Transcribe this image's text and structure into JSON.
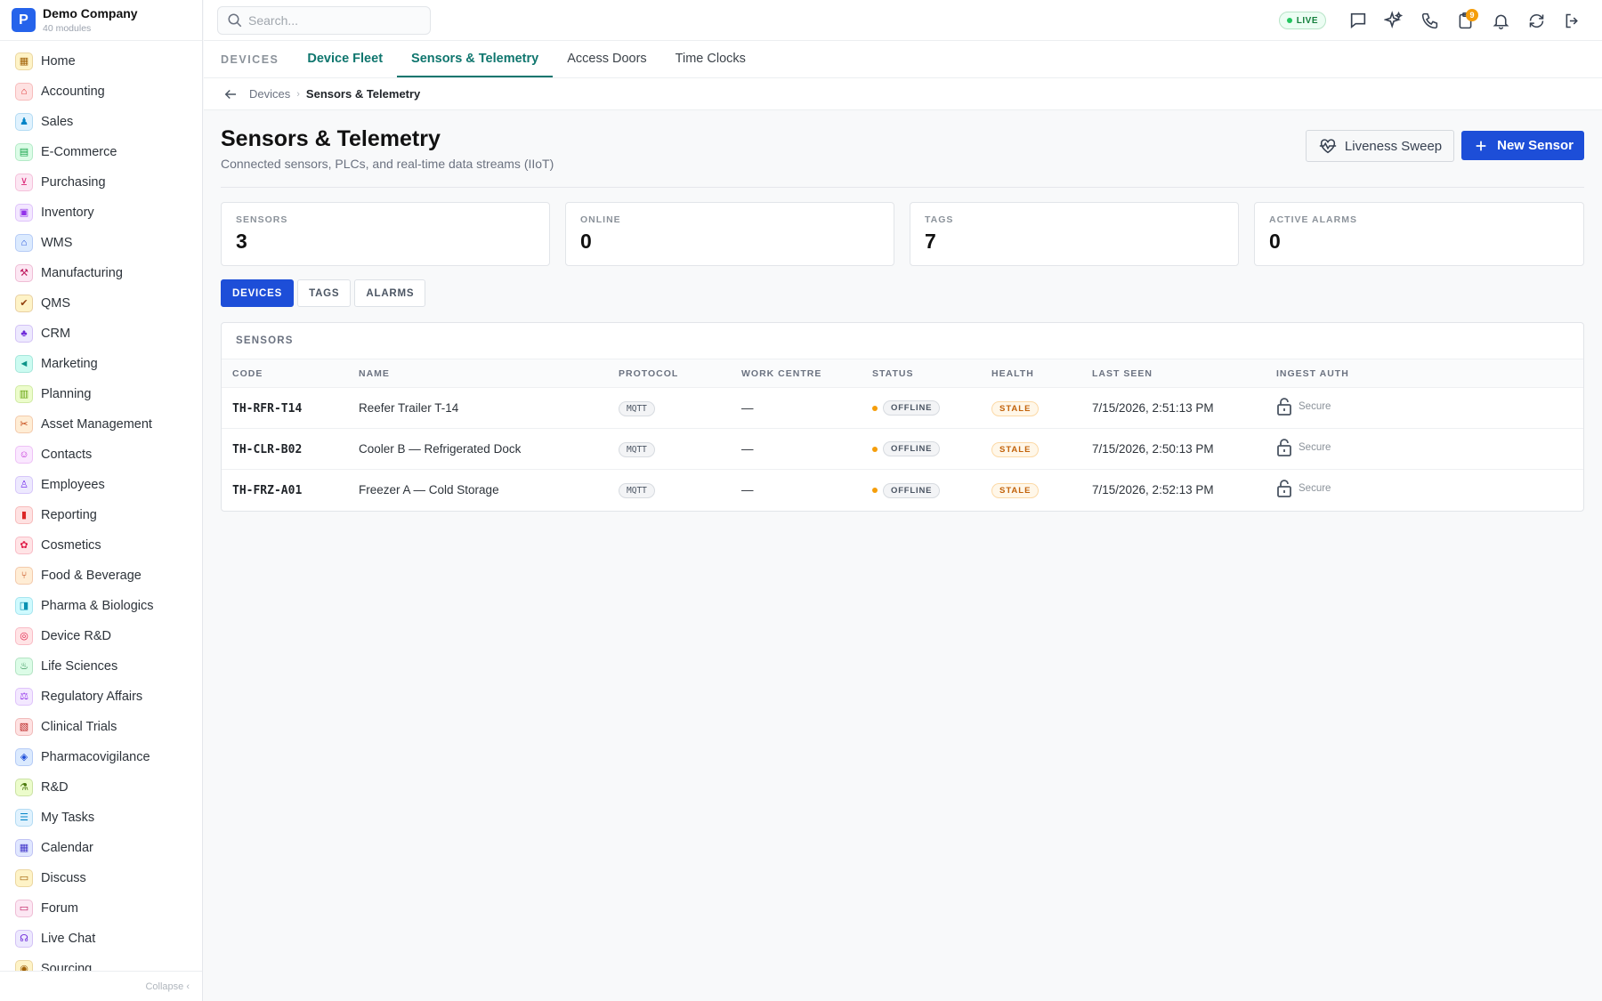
{
  "brand": {
    "logo_letter": "P",
    "name": "Demo Company",
    "sub": "40 modules"
  },
  "sidebar": {
    "items": [
      {
        "label": "Home",
        "icon": "grid-icon",
        "glyph": "▦",
        "color": "#a16207",
        "bg": "#fef3c7"
      },
      {
        "label": "Accounting",
        "icon": "bank-icon",
        "glyph": "⌂",
        "color": "#dc2626",
        "bg": "#fee2e2"
      },
      {
        "label": "Sales",
        "icon": "person-icon",
        "glyph": "♟",
        "color": "#0284c7",
        "bg": "#e0f2fe"
      },
      {
        "label": "E-Commerce",
        "icon": "store-icon",
        "glyph": "▤",
        "color": "#16a34a",
        "bg": "#dcfce7"
      },
      {
        "label": "Purchasing",
        "icon": "cart-icon",
        "glyph": "⊻",
        "color": "#db2777",
        "bg": "#fce7f3"
      },
      {
        "label": "Inventory",
        "icon": "box-icon",
        "glyph": "▣",
        "color": "#9333ea",
        "bg": "#f3e8ff"
      },
      {
        "label": "WMS",
        "icon": "warehouse-icon",
        "glyph": "⌂",
        "color": "#1d4ed8",
        "bg": "#dbeafe"
      },
      {
        "label": "Manufacturing",
        "icon": "factory-icon",
        "glyph": "⚒",
        "color": "#be185d",
        "bg": "#fce7f3"
      },
      {
        "label": "QMS",
        "icon": "badge-check-icon",
        "glyph": "✔",
        "color": "#92400e",
        "bg": "#fef3c7"
      },
      {
        "label": "CRM",
        "icon": "users-icon",
        "glyph": "♣",
        "color": "#6d28d9",
        "bg": "#ede9fe"
      },
      {
        "label": "Marketing",
        "icon": "megaphone-icon",
        "glyph": "◄",
        "color": "#0d9488",
        "bg": "#ccfbf1"
      },
      {
        "label": "Planning",
        "icon": "calendar-icon",
        "glyph": "▥",
        "color": "#65a30d",
        "bg": "#ecfccb"
      },
      {
        "label": "Asset Management",
        "icon": "tools-icon",
        "glyph": "✂",
        "color": "#c2410c",
        "bg": "#ffedd5"
      },
      {
        "label": "Contacts",
        "icon": "contact-icon",
        "glyph": "☺",
        "color": "#c026d3",
        "bg": "#fae8ff"
      },
      {
        "label": "Employees",
        "icon": "employee-icon",
        "glyph": "♙",
        "color": "#7c3aed",
        "bg": "#ede9fe"
      },
      {
        "label": "Reporting",
        "icon": "bar-chart-icon",
        "glyph": "▮",
        "color": "#dc2626",
        "bg": "#fee2e2"
      },
      {
        "label": "Cosmetics",
        "icon": "flower-icon",
        "glyph": "✿",
        "color": "#e11d48",
        "bg": "#ffe4e6"
      },
      {
        "label": "Food & Beverage",
        "icon": "utensils-icon",
        "glyph": "⑂",
        "color": "#c2410c",
        "bg": "#ffedd5"
      },
      {
        "label": "Pharma & Biologics",
        "icon": "pill-icon",
        "glyph": "◨",
        "color": "#0891b2",
        "bg": "#cffafe"
      },
      {
        "label": "Device R&D",
        "icon": "chip-icon",
        "glyph": "◎",
        "color": "#e11d48",
        "bg": "#ffe4e6"
      },
      {
        "label": "Life Sciences",
        "icon": "microscope-icon",
        "glyph": "♨",
        "color": "#15803d",
        "bg": "#dcfce7"
      },
      {
        "label": "Regulatory Affairs",
        "icon": "gavel-icon",
        "glyph": "⚖",
        "color": "#9333ea",
        "bg": "#f3e8ff"
      },
      {
        "label": "Clinical Trials",
        "icon": "clipboard-icon",
        "glyph": "▧",
        "color": "#b91c1c",
        "bg": "#fee2e2"
      },
      {
        "label": "Pharmacovigilance",
        "icon": "shield-icon",
        "glyph": "◈",
        "color": "#1d4ed8",
        "bg": "#dbeafe"
      },
      {
        "label": "R&D",
        "icon": "flask-icon",
        "glyph": "⚗",
        "color": "#4d7c0f",
        "bg": "#ecfccb"
      },
      {
        "label": "My Tasks",
        "icon": "checklist-icon",
        "glyph": "☰",
        "color": "#0284c7",
        "bg": "#e0f2fe"
      },
      {
        "label": "Calendar",
        "icon": "calendar-icon",
        "glyph": "▦",
        "color": "#4338ca",
        "bg": "#e0e7ff"
      },
      {
        "label": "Discuss",
        "icon": "chat-icon",
        "glyph": "▭",
        "color": "#a16207",
        "bg": "#fef3c7"
      },
      {
        "label": "Forum",
        "icon": "forum-icon",
        "glyph": "▭",
        "color": "#be185d",
        "bg": "#fce7f3"
      },
      {
        "label": "Live Chat",
        "icon": "headset-icon",
        "glyph": "☊",
        "color": "#6d28d9",
        "bg": "#ede9fe"
      },
      {
        "label": "Sourcing",
        "icon": "sourcing-icon",
        "glyph": "◉",
        "color": "#a16207",
        "bg": "#fef3c7"
      }
    ],
    "collapse_label": "Collapse ‹"
  },
  "topbar": {
    "search_placeholder": "Search...",
    "live_label": "LIVE",
    "notification_count": "9"
  },
  "section_tabs": {
    "section": "DEVICES",
    "tabs": [
      "Device Fleet",
      "Sensors & Telemetry",
      "Access Doors",
      "Time Clocks"
    ],
    "active_index": 1
  },
  "breadcrumb": {
    "parent": "Devices",
    "separator": "›",
    "current": "Sensors & Telemetry"
  },
  "page": {
    "title": "Sensors & Telemetry",
    "subtitle": "Connected sensors, PLCs, and real-time data streams (IIoT)",
    "liveness_button": "Liveness Sweep",
    "new_button": "New Sensor"
  },
  "stats": [
    {
      "label": "SENSORS",
      "value": "3"
    },
    {
      "label": "ONLINE",
      "value": "0"
    },
    {
      "label": "TAGS",
      "value": "7"
    },
    {
      "label": "ACTIVE ALARMS",
      "value": "0"
    }
  ],
  "subtabs": [
    "DEVICES",
    "TAGS",
    "ALARMS"
  ],
  "table": {
    "title": "SENSORS",
    "columns": [
      "CODE",
      "NAME",
      "PROTOCOL",
      "WORK CENTRE",
      "STATUS",
      "HEALTH",
      "LAST SEEN",
      "INGEST AUTH"
    ],
    "rows": [
      {
        "code": "TH-RFR-T14",
        "name": "Reefer Trailer T-14",
        "protocol": "MQTT",
        "work_centre": "—",
        "status": "OFFLINE",
        "health": "STALE",
        "last_seen": "7/15/2026, 2:51:13 PM",
        "auth": "Secure"
      },
      {
        "code": "TH-CLR-B02",
        "name": "Cooler B — Refrigerated Dock",
        "protocol": "MQTT",
        "work_centre": "—",
        "status": "OFFLINE",
        "health": "STALE",
        "last_seen": "7/15/2026, 2:50:13 PM",
        "auth": "Secure"
      },
      {
        "code": "TH-FRZ-A01",
        "name": "Freezer A — Cold Storage",
        "protocol": "MQTT",
        "work_centre": "—",
        "status": "OFFLINE",
        "health": "STALE",
        "last_seen": "7/15/2026, 2:52:13 PM",
        "auth": "Secure"
      }
    ]
  },
  "colors": {
    "accent": "#0f766e",
    "primary": "#1d4ed8",
    "warning": "#f59e0b",
    "live": "#22c55e"
  }
}
